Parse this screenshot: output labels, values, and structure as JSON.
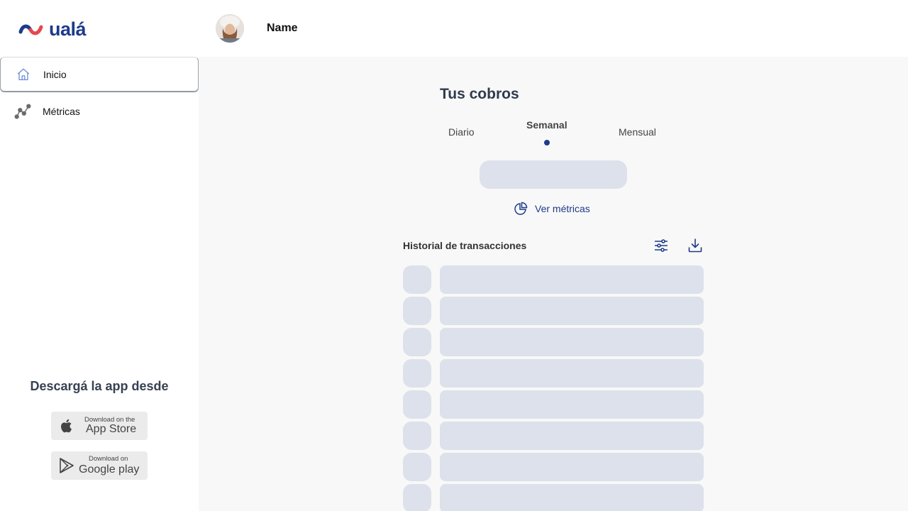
{
  "brand": {
    "name": "ualá",
    "accent": "#1e3a8a",
    "wave_colors": [
      "#1e3a8a",
      "#e5484d"
    ]
  },
  "sidebar": {
    "items": [
      {
        "label": "Inicio",
        "icon": "home-icon",
        "active": true
      },
      {
        "label": "Métricas",
        "icon": "metrics-icon",
        "active": false
      }
    ],
    "download_title": "Descargá la app desde",
    "app_store": {
      "small": "Download on the",
      "big": "App Store",
      "icon": "apple-icon"
    },
    "google_play": {
      "small": "Download on",
      "big": "Google play",
      "icon": "google-play-icon"
    }
  },
  "header": {
    "user_name": "Name",
    "avatar": "user-avatar"
  },
  "main": {
    "title": "Tus cobros",
    "tabs": [
      {
        "label": "Diario",
        "selected": false
      },
      {
        "label": "Semanal",
        "selected": true
      },
      {
        "label": "Mensual",
        "selected": false
      }
    ],
    "ver_metricas": "Ver métricas",
    "historial_title": "Historial de transacciones",
    "skeleton_color": "#dde1eb"
  }
}
